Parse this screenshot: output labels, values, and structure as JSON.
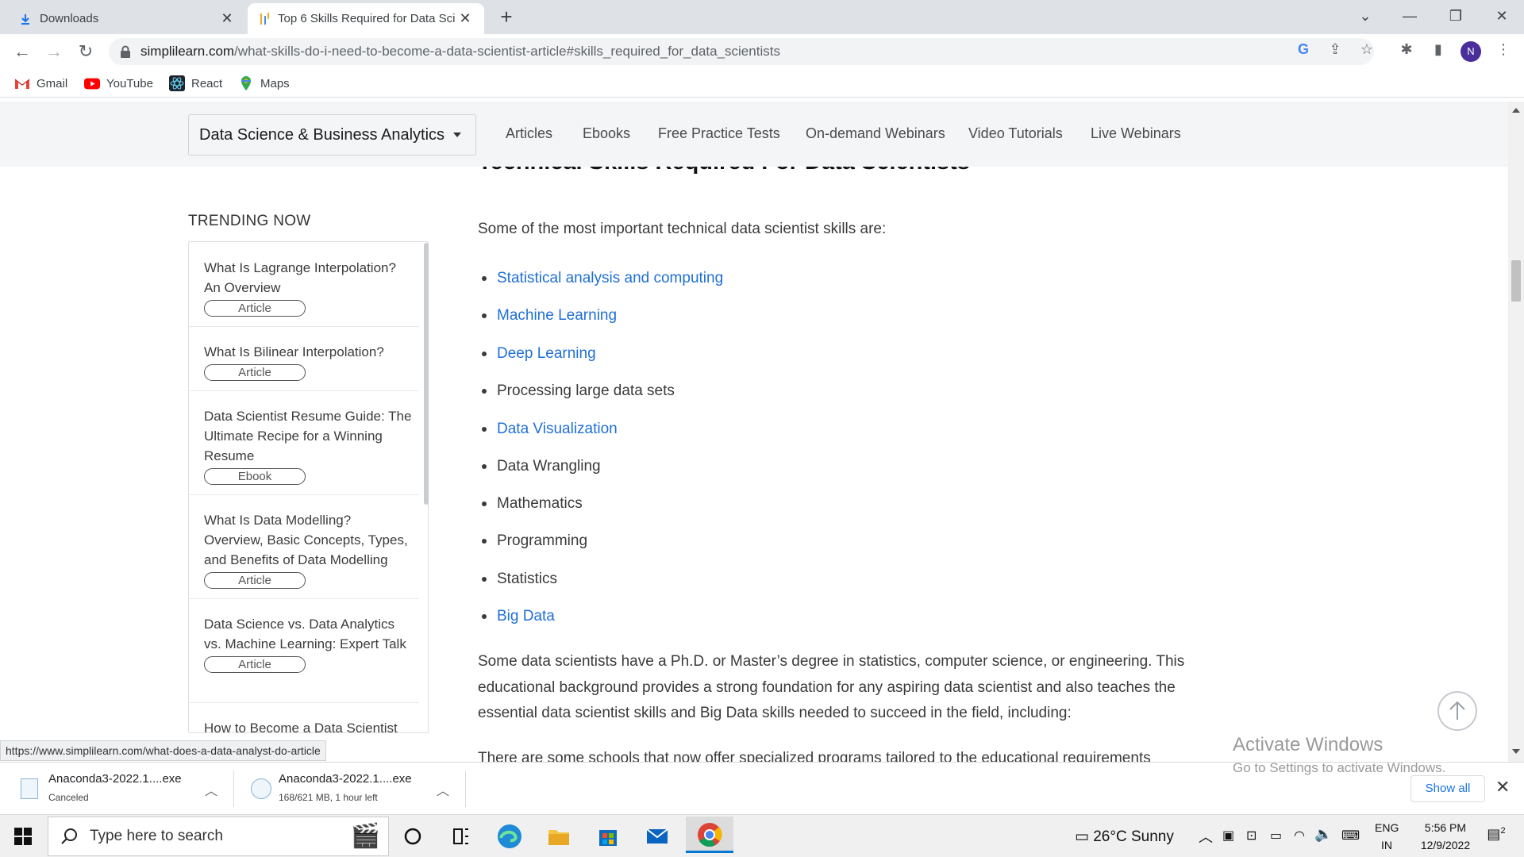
{
  "tabs": [
    {
      "title": "Downloads",
      "icon": "download-icon"
    },
    {
      "title": "Top 6 Skills Required for Data Sci",
      "icon": "simplilearn-favicon"
    }
  ],
  "address_bar": {
    "url_domain": "simplilearn.com",
    "url_path": "/what-skills-do-i-need-to-become-a-data-scientist-article#skills_required_for_data_scientists"
  },
  "profile_initial": "N",
  "bookmarks": [
    {
      "label": "Gmail",
      "icon": "gmail-icon"
    },
    {
      "label": "YouTube",
      "icon": "youtube-icon"
    },
    {
      "label": "React",
      "icon": "react-icon"
    },
    {
      "label": "Maps",
      "icon": "maps-icon"
    }
  ],
  "subnav": {
    "category": "Data Science & Business Analytics",
    "links": [
      "Articles",
      "Ebooks",
      "Free Practice Tests",
      "On-demand Webinars",
      "Video Tutorials",
      "Live Webinars"
    ]
  },
  "article": {
    "heading": "Technical Skills Required For Data Scientists",
    "intro": "Some of the most important technical data scientist skills are:",
    "skills": [
      {
        "text": "Statistical analysis and computing",
        "link": true
      },
      {
        "text": "Machine Learning",
        "link": true
      },
      {
        "text": "Deep Learning",
        "link": true
      },
      {
        "text": "Processing large data sets",
        "link": false
      },
      {
        "text": "Data Visualization",
        "link": true
      },
      {
        "text": "Data Wrangling",
        "link": false
      },
      {
        "text": "Mathematics",
        "link": false
      },
      {
        "text": "Programming",
        "link": false
      },
      {
        "text": "Statistics",
        "link": false
      },
      {
        "text": "Big Data",
        "link": true
      }
    ],
    "paragraph": "Some data scientists have a Ph.D. or Master’s degree in statistics, computer science, or engineering. This educational background provides a strong foundation for any aspiring data scientist and also teaches the essential data scientist skills and Big Data skills needed to succeed in the field, including:",
    "paragraph_next": "There are some schools that now offer specialized programs tailored to the educational requirements"
  },
  "trending": {
    "title": "TRENDING NOW",
    "items": [
      {
        "title": "What Is Lagrange Interpolation? An Overview",
        "badge": "Article"
      },
      {
        "title": "What Is Bilinear Interpolation?",
        "badge": "Article"
      },
      {
        "title": "Data Scientist Resume Guide: The Ultimate Recipe for a Winning Resume",
        "badge": "Ebook"
      },
      {
        "title": "What Is Data Modelling? Overview, Basic Concepts, Types, and Benefits of Data Modelling",
        "badge": "Article"
      },
      {
        "title": "Data Science vs. Data Analytics vs. Machine Learning: Expert Talk",
        "badge": "Article"
      },
      {
        "title": "How to Become a Data Scientist",
        "badge": ""
      }
    ]
  },
  "status_url": "https://www.simplilearn.com/what-does-a-data-analyst-do-article",
  "watermark": {
    "line1": "Activate Windows",
    "line2": "Go to Settings to activate Windows."
  },
  "downloads": [
    {
      "name": "Anaconda3-2022.1....exe",
      "status": "Canceled"
    },
    {
      "name": "Anaconda3-2022.1....exe",
      "status": "168/621 MB, 1 hour left"
    }
  ],
  "download_bar": {
    "show_all": "Show all"
  },
  "taskbar": {
    "search_placeholder": "Type here to search",
    "weather": "26°C  Sunny",
    "lang_top": "ENG",
    "lang_bottom": "IN",
    "time": "5:56 PM",
    "date": "12/9/2022",
    "notif_count": "2"
  },
  "colors": {
    "link": "#1f6fd6",
    "accent": "#1a73e8",
    "profile": "#4a2e9c"
  }
}
